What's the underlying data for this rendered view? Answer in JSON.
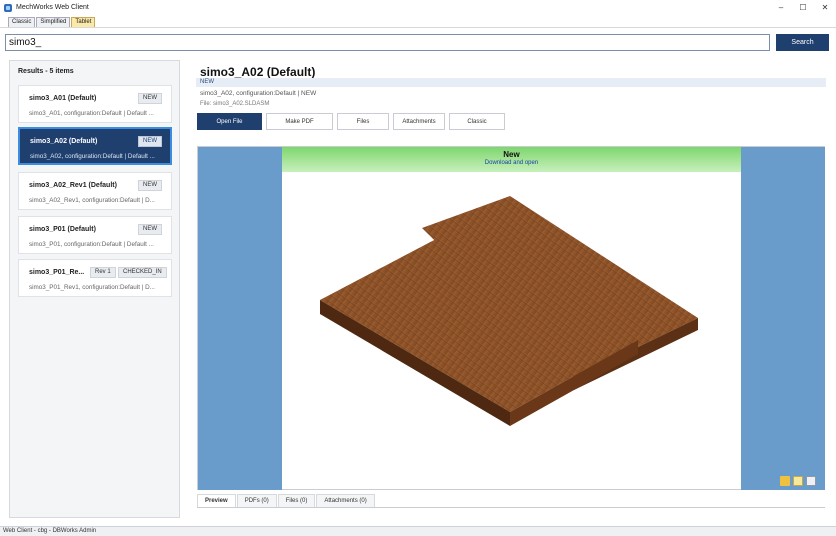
{
  "window": {
    "title": "MechWorks Web Client",
    "minimize": "–",
    "maximize": "☐",
    "close": "✕"
  },
  "mode_tabs": [
    "Classic",
    "Simplified",
    "Tablet"
  ],
  "search": {
    "value": "simo3_",
    "button": "Search"
  },
  "results": {
    "title": "Results - 5 items",
    "items": [
      {
        "title": "simo3_A01 (Default)",
        "sub": "simo3_A01, configuration:Default | Default ...",
        "badges": [
          "NEW"
        ]
      },
      {
        "title": "simo3_A02 (Default)",
        "sub": "simo3_A02, configuration:Default | Default ...",
        "badges": [
          "NEW"
        ]
      },
      {
        "title": "simo3_A02_Rev1 (Default)",
        "sub": "simo3_A02_Rev1, configuration:Default | D...",
        "badges": [
          "NEW"
        ]
      },
      {
        "title": "simo3_P01 (Default)",
        "sub": "simo3_P01, configuration:Default | Default ...",
        "badges": [
          "NEW"
        ]
      },
      {
        "title": "simo3_P01_Re...",
        "sub": "simo3_P01_Rev1, configuration:Default | D...",
        "badges": [
          "Rev 1",
          "CHECKED_IN"
        ]
      }
    ]
  },
  "detail": {
    "title": "simo3_A02 (Default)",
    "status": "NEW",
    "config": "simo3_A02, configuration:Default | NEW",
    "file": "File: simo3_A02.SLDASM",
    "actions": [
      "Open File",
      "Make PDF",
      "Files",
      "Attachments",
      "Classic"
    ]
  },
  "preview": {
    "banner_title": "New",
    "banner_link": "Download and open",
    "tabs": [
      "Preview",
      "PDFs (0)",
      "Files (0)",
      "Attachments (0)"
    ]
  },
  "statusbar": "Web Client - cbg - DBWorks Admin",
  "colors": {
    "primary": "#1f3f6e",
    "selected_border": "#3a8de0",
    "side_bar": "#6a9ccb",
    "banner_green": "#7ed66e",
    "wood": "#8a4f26"
  }
}
